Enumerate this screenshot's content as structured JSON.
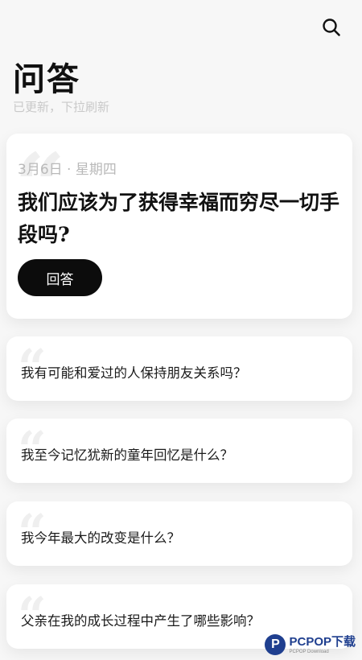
{
  "header": {
    "title": "问答",
    "refresh_hint": "已更新，下拉刷新"
  },
  "featured": {
    "date": "3月6日 · 星期四",
    "question": "我们应该为了获得幸福而穷尽一切手段吗?",
    "answer_label": "回答",
    "quote": "“"
  },
  "questions": [
    {
      "text": "我有可能和爱过的人保持朋友关系吗？",
      "quote": "“"
    },
    {
      "text": "我至今记忆犹新的童年回忆是什么？",
      "quote": "“"
    },
    {
      "text": "我今年最大的改变是什么？",
      "quote": "“"
    },
    {
      "text": "父亲在我的成长过程中产生了哪些影响？",
      "quote": "“"
    }
  ],
  "watermark": {
    "logo_letter": "P",
    "brand": "PCPOP下载",
    "sub": "PCPOP Download"
  },
  "icons": {
    "search": "search-icon"
  },
  "colors": {
    "background": "#f7f7f7",
    "card": "#ffffff",
    "button": "#0c0c0c",
    "hint": "#c9c9c9"
  }
}
